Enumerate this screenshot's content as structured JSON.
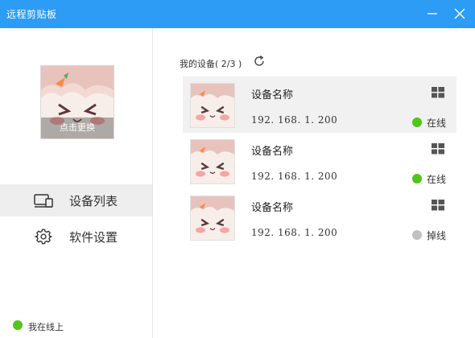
{
  "window": {
    "title": "远程剪贴板"
  },
  "profile": {
    "change_avatar_label": "点击更换"
  },
  "nav": {
    "items": [
      {
        "label": "设备列表",
        "icon": "devices-icon",
        "active": true
      },
      {
        "label": "软件设置",
        "icon": "gear-icon",
        "active": false
      }
    ]
  },
  "status": {
    "online_text": "我在线上",
    "online_color": "#52c41a",
    "offline_color": "#c0c0c0"
  },
  "devices_section": {
    "title": "我的设备( 2/3 )"
  },
  "devices": [
    {
      "name": "设备名称",
      "ip": "192. 168. 1. 200",
      "status": "在线",
      "os_icon": "windows-icon"
    },
    {
      "name": "设备名称",
      "ip": "192. 168. 1. 200",
      "status": "在线",
      "os_icon": "windows-icon"
    },
    {
      "name": "设备名称",
      "ip": "192. 168. 1. 200",
      "status": "掉线",
      "os_icon": "windows-icon"
    }
  ],
  "colors": {
    "titlebar": "#2d9cf5",
    "accent": "#2d9cf5"
  }
}
